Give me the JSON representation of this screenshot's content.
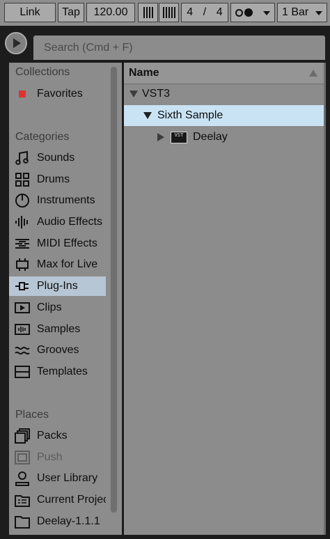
{
  "toolbar": {
    "link_label": "Link",
    "tap_label": "Tap",
    "tempo": "120.00",
    "sig_numerator": "4",
    "sig_separator": "/",
    "sig_denominator": "4",
    "quantization": "1 Bar"
  },
  "search": {
    "placeholder": "Search (Cmd + F)"
  },
  "sidebar": {
    "collections_header": "Collections",
    "favorites_label": "Favorites",
    "categories_header": "Categories",
    "categories": [
      {
        "label": "Sounds",
        "icon": "sounds-icon"
      },
      {
        "label": "Drums",
        "icon": "drums-icon"
      },
      {
        "label": "Instruments",
        "icon": "instruments-icon"
      },
      {
        "label": "Audio Effects",
        "icon": "audio-effects-icon"
      },
      {
        "label": "MIDI Effects",
        "icon": "midi-effects-icon"
      },
      {
        "label": "Max for Live",
        "icon": "max-for-live-icon"
      },
      {
        "label": "Plug-Ins",
        "icon": "plug-ins-icon",
        "selected": true
      },
      {
        "label": "Clips",
        "icon": "clips-icon"
      },
      {
        "label": "Samples",
        "icon": "samples-icon"
      },
      {
        "label": "Grooves",
        "icon": "grooves-icon"
      },
      {
        "label": "Templates",
        "icon": "templates-icon"
      }
    ],
    "places_header": "Places",
    "places": [
      {
        "label": "Packs",
        "icon": "packs-icon"
      },
      {
        "label": "Push",
        "icon": "push-icon",
        "dimmed": true
      },
      {
        "label": "User Library",
        "icon": "user-library-icon"
      },
      {
        "label": "Current Project",
        "icon": "current-project-icon"
      },
      {
        "label": "Deelay-1.1.1",
        "icon": "folder-icon"
      }
    ],
    "favorite_color": "#e03232",
    "selected_color": "#b7c6d4"
  },
  "content": {
    "column_header": "Name",
    "tree": [
      {
        "label": "VST3",
        "expanded": true
      },
      {
        "label": "Sixth Sample",
        "expanded": true,
        "selected": true
      },
      {
        "label": "Deelay",
        "expanded": false,
        "badge": "VST"
      }
    ],
    "selected_color": "#c9e3f4"
  }
}
